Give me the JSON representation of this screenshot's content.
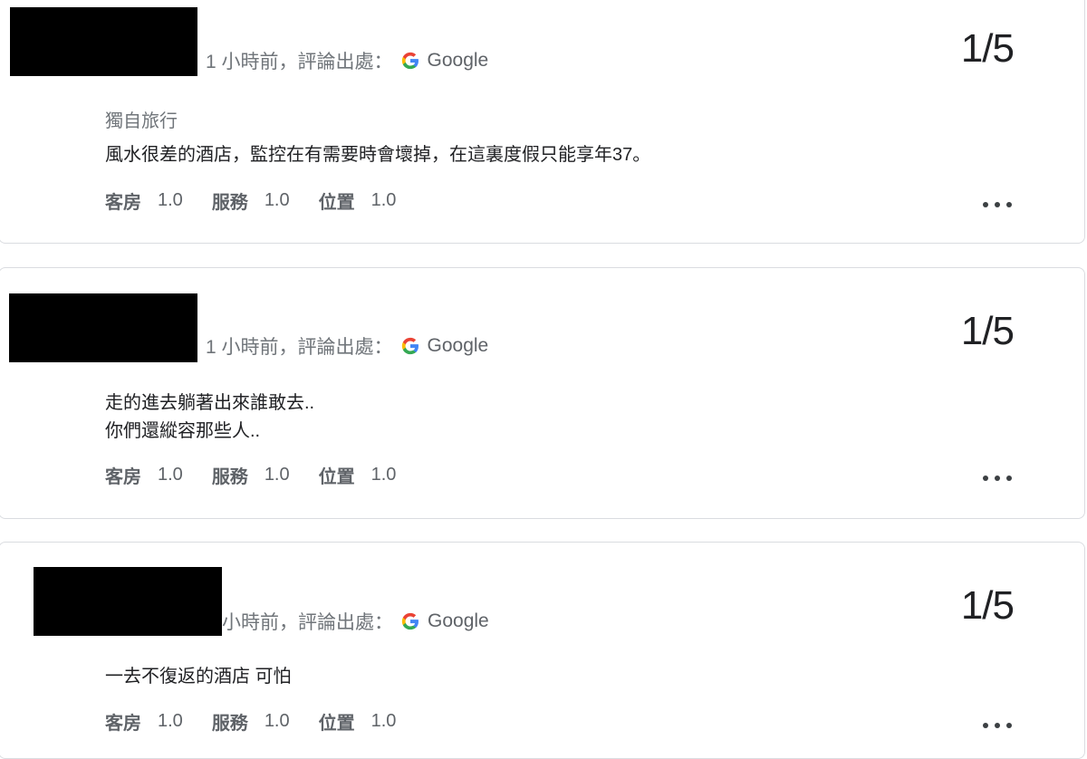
{
  "reviews": [
    {
      "time_ago": "1 小時前，評論出處：",
      "source": "Google",
      "score": "1/5",
      "trip_type": "獨自旅行",
      "text": "風水很差的酒店，監控在有需要時會壞掉，在這裏度假只能享年37。",
      "ratings": [
        {
          "label": "客房",
          "value": "1.0"
        },
        {
          "label": "服務",
          "value": "1.0"
        },
        {
          "label": "位置",
          "value": "1.0"
        }
      ],
      "more_icon": "more-horiz-icon"
    },
    {
      "time_ago": "1 小時前，評論出處：",
      "source": "Google",
      "score": "1/5",
      "text": "走的進去躺著出來誰敢去..\n你們還縱容那些人..",
      "ratings": [
        {
          "label": "客房",
          "value": "1.0"
        },
        {
          "label": "服務",
          "value": "1.0"
        },
        {
          "label": "位置",
          "value": "1.0"
        }
      ],
      "more_icon": "more-horiz-icon"
    },
    {
      "time_ago": "小時前，評論出處：",
      "source": "Google",
      "score": "1/5",
      "text": "一去不復返的酒店 可怕",
      "ratings": [
        {
          "label": "客房",
          "value": "1.0"
        },
        {
          "label": "服務",
          "value": "1.0"
        },
        {
          "label": "位置",
          "value": "1.0"
        }
      ],
      "more_icon": "more-horiz-icon"
    }
  ],
  "colors": {
    "google_blue": "#4285F4",
    "google_red": "#EA4335",
    "google_yellow": "#FBBC05",
    "google_green": "#34A853",
    "redaction": "#000000"
  }
}
